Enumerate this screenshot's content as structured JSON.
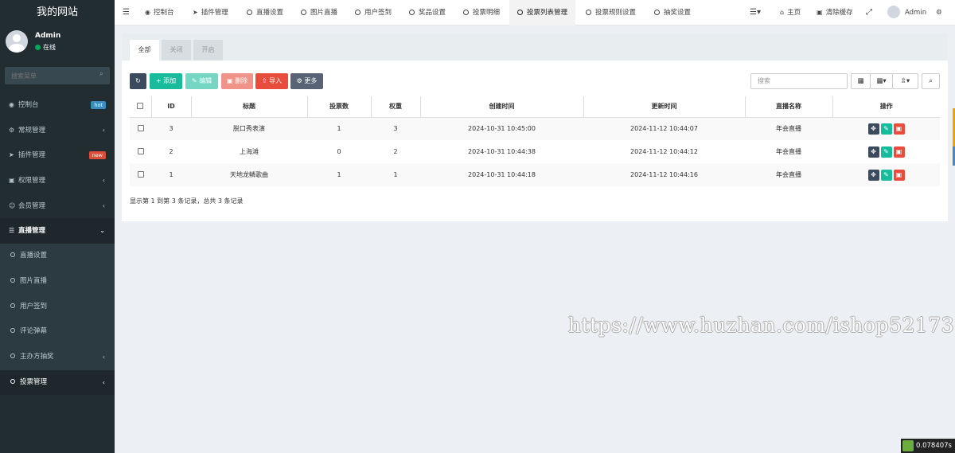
{
  "sidebar": {
    "logo": "我的网站",
    "user": {
      "name": "Admin",
      "status": "在线"
    },
    "search_placeholder": "搜索菜单",
    "items": [
      {
        "label": "控制台",
        "icon": "dashboard-icon",
        "badge": "hot",
        "badge_color": "#3c8dbc"
      },
      {
        "label": "常规管理",
        "icon": "cogs-icon"
      },
      {
        "label": "插件管理",
        "icon": "rocket-icon",
        "badge": "new",
        "badge_color": "#dd4b39"
      },
      {
        "label": "权限管理",
        "icon": "group-icon"
      },
      {
        "label": "会员管理",
        "icon": "user-circle-icon"
      },
      {
        "label": "直播管理",
        "icon": "list-icon"
      }
    ],
    "subitems": [
      {
        "label": "直播设置"
      },
      {
        "label": "图片直播"
      },
      {
        "label": "用户签到"
      },
      {
        "label": "评论弹幕"
      },
      {
        "label": "主办方抽奖"
      },
      {
        "label": "投票管理"
      }
    ]
  },
  "topbar": {
    "tabs": [
      {
        "label": "控制台"
      },
      {
        "label": "插件管理"
      },
      {
        "label": "直播设置"
      },
      {
        "label": "图片直播"
      },
      {
        "label": "用户签到"
      },
      {
        "label": "奖品设置"
      },
      {
        "label": "投票明细"
      },
      {
        "label": "投票列表管理"
      },
      {
        "label": "投票规则设置"
      },
      {
        "label": "抽奖设置"
      }
    ],
    "home": "主页",
    "clear_cache": "清除缓存",
    "user": "Admin"
  },
  "filter_tabs": [
    "全部",
    "关闭",
    "开启"
  ],
  "toolbar": {
    "add": "添加",
    "edit": "编辑",
    "delete": "删除",
    "import": "导入",
    "more": "更多",
    "search_placeholder": "搜索"
  },
  "colors": {
    "primary_dark": "#3c4a5d",
    "success": "#18bc9c",
    "danger": "#e74c3c",
    "default": "#95a5a6"
  },
  "table": {
    "headers": [
      "ID",
      "标题",
      "投票数",
      "权重",
      "创建时间",
      "更新时间",
      "直播名称",
      "操作"
    ],
    "rows": [
      {
        "id": "3",
        "title": "脱口秀表演",
        "votes": "1",
        "weight": "3",
        "created": "2024-10-31 10:45:00",
        "updated": "2024-11-12 10:44:07",
        "live": "年会直播"
      },
      {
        "id": "2",
        "title": "上海滩",
        "votes": "0",
        "weight": "2",
        "created": "2024-10-31 10:44:38",
        "updated": "2024-11-12 10:44:12",
        "live": "年会直播"
      },
      {
        "id": "1",
        "title": "天地龙鳞歌曲",
        "votes": "1",
        "weight": "1",
        "created": "2024-10-31 10:44:18",
        "updated": "2024-11-12 10:44:16",
        "live": "年会直播"
      }
    ]
  },
  "pagination_text": "显示第 1 到第 3 条记录，总共 3 条记录",
  "watermark": "https://www.huzhan.com/ishop52173",
  "timer": "0.078407s"
}
